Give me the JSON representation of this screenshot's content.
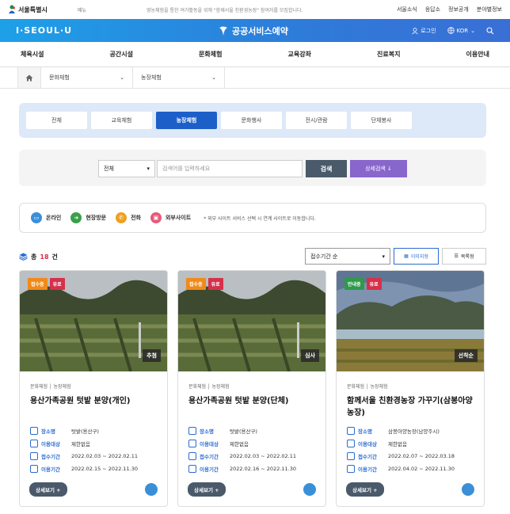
{
  "topbar": {
    "logo_text": "서울특별시",
    "share": "메뉴",
    "notice": "영농체험을 통한 여가활동을 위해 \"함께서울 친환경농장\" 참여자를 모집합니다.",
    "links": [
      "서울소식",
      "응답소",
      "정보공개",
      "분야별정보"
    ]
  },
  "header": {
    "brand": "I·SEOUL·U",
    "service_title": "공공서비스예약",
    "login": "로그인",
    "language": "KOR"
  },
  "gnb": [
    "체육시설",
    "공간시설",
    "문화체험",
    "교육강좌",
    "진료복지",
    "이용안내"
  ],
  "breadcrumb": [
    "문화체험",
    "농장체험"
  ],
  "tabs": [
    "전체",
    "교육체험",
    "농장체험",
    "문화행사",
    "전시/관람",
    "단체봉사"
  ],
  "active_tab": 2,
  "search": {
    "select_value": "전체",
    "placeholder": "검색어를 입력하세요",
    "search_label": "검색",
    "detail_label": "상세검색 ↓"
  },
  "legend": {
    "items": [
      {
        "label": "온라인",
        "color": "#3a8fd8"
      },
      {
        "label": "현장방문",
        "color": "#3aa04a"
      },
      {
        "label": "전화",
        "color": "#f0a020"
      },
      {
        "label": "외부사이트",
        "color": "#e65a7a"
      }
    ],
    "note": "* 외부 사이트 서비스 선택 시 연계 사이트로 이동합니다."
  },
  "results": {
    "count_prefix": "총",
    "count": "18",
    "count_suffix": "건",
    "sort_value": "접수기간 순",
    "view_image": "이미지형",
    "view_list": "목록형"
  },
  "row_labels": {
    "place": "장소명",
    "target": "이용대상",
    "reg": "접수기간",
    "use": "이용기간"
  },
  "card_more": "상세보기 +",
  "cards": [
    {
      "status": "접수중",
      "status_color": "#f08a1a",
      "fee": "유료",
      "corner": "추첨",
      "category": "문화체험 │ 농장체험",
      "title": "용산가족공원 텃밭 분양(개인)",
      "place": "텃밭(용산구)",
      "target": "제한없음",
      "reg": "2022.02.03 ~ 2022.02.11",
      "use": "2022.02.15 ~ 2022.11.30"
    },
    {
      "status": "접수중",
      "status_color": "#f08a1a",
      "fee": "유료",
      "corner": "심사",
      "category": "문화체험 │ 농장체험",
      "title": "용산가족공원 텃밭 분양(단체)",
      "place": "텃밭(용산구)",
      "target": "제한없음",
      "reg": "2022.02.03 ~ 2022.02.11",
      "use": "2022.02.16 ~ 2022.11.30"
    },
    {
      "status": "안내중",
      "status_color": "#2e9a4a",
      "fee": "유료",
      "corner": "선착순",
      "category": "문화체험 │ 농장체험",
      "title": "함께서울 친환경농장 가꾸기(삼봉아양농장)",
      "place": "삼봉아양농장(남양주시)",
      "target": "제한없음",
      "reg": "2022.02.07 ~ 2022.03.18",
      "use": "2022.04.02 ~ 2022.11.30"
    }
  ]
}
